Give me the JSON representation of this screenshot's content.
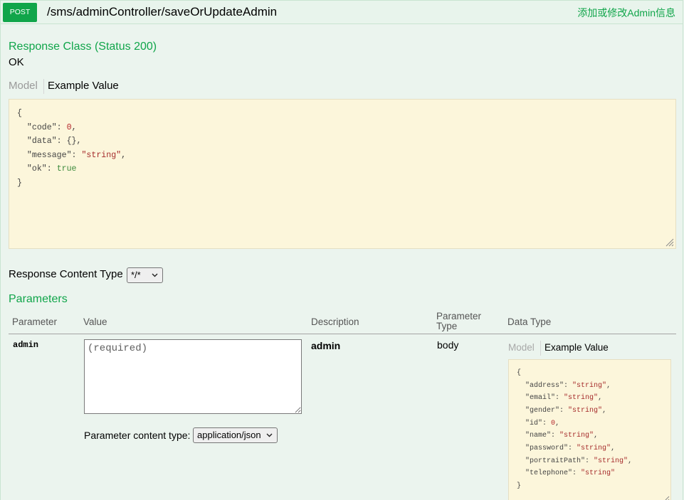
{
  "operation": {
    "method": "POST",
    "path": "/sms/adminController/saveOrUpdateAdmin",
    "summary": "添加或修改Admin信息"
  },
  "response_class": {
    "heading": "Response Class (Status 200)",
    "status_text": "OK",
    "tabs": {
      "model": "Model",
      "example": "Example Value",
      "example_active": true
    },
    "example_value": {
      "code": 0,
      "data": {},
      "message": "string",
      "ok": true
    }
  },
  "response_content_type": {
    "label": "Response Content Type",
    "selected": "*/*"
  },
  "parameters": {
    "heading": "Parameters",
    "columns": [
      "Parameter",
      "Value",
      "Description",
      "Parameter Type",
      "Data Type"
    ],
    "rows": [
      {
        "name": "admin",
        "value": "",
        "value_placeholder": "(required)",
        "description": "admin",
        "param_type": "body",
        "content_type_label": "Parameter content type:",
        "content_type_selected": "application/json",
        "data_type_tabs": {
          "model": "Model",
          "example": "Example Value",
          "example_active": true
        },
        "example_value": {
          "address": "string",
          "email": "string",
          "gender": "string",
          "id": 0,
          "name": "string",
          "password": "string",
          "portraitPath": "string",
          "telephone": "string"
        }
      }
    ]
  },
  "icons": {
    "select_arrow": "chevron-down-icon",
    "resize_grip": "resize-grip-icon"
  },
  "colors": {
    "post_accent": "#10a54a",
    "panel_background": "#ebf4ee",
    "panel_border": "#c9e4d1",
    "code_background": "#fcf6db",
    "code_border": "#e5dfc3",
    "inactive_tab": "#9a9a9a"
  }
}
